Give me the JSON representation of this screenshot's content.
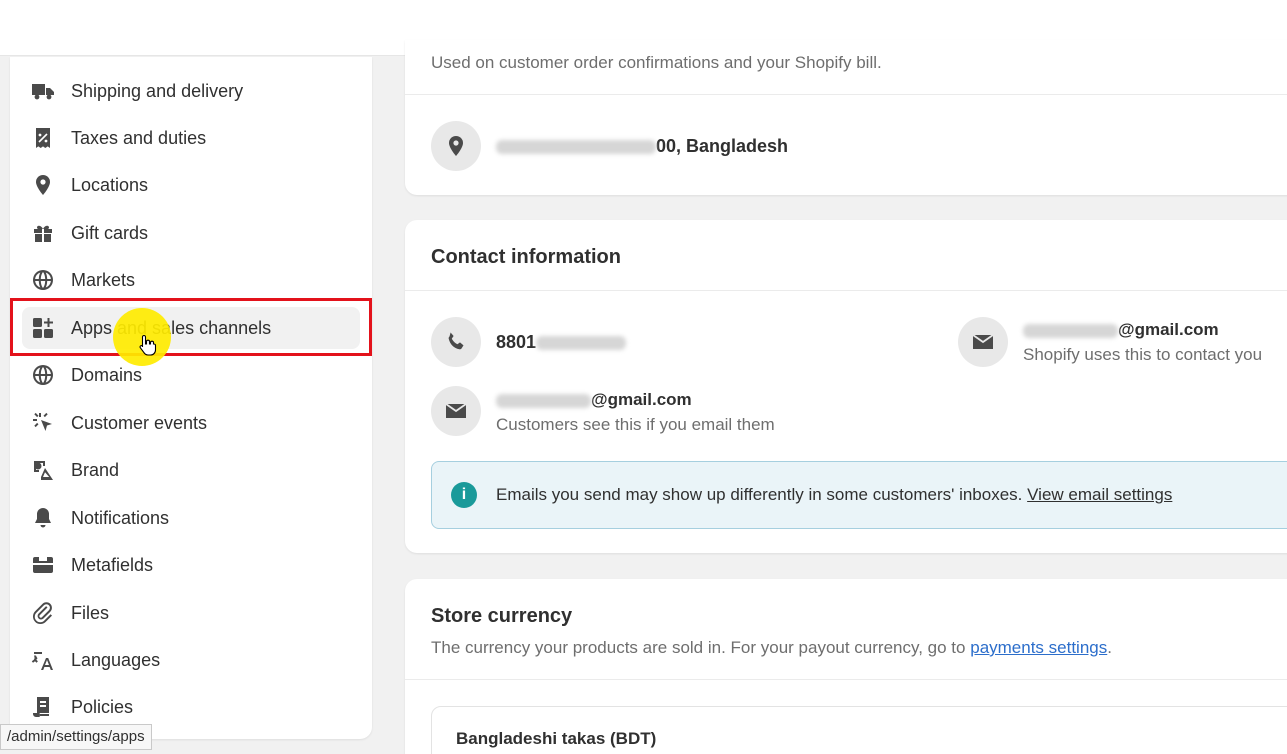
{
  "sidebar": {
    "items": [
      {
        "label": "Shipping and delivery",
        "icon": "truck-icon"
      },
      {
        "label": "Taxes and duties",
        "icon": "receipt-icon"
      },
      {
        "label": "Locations",
        "icon": "location-pin-icon"
      },
      {
        "label": "Gift cards",
        "icon": "gift-icon"
      },
      {
        "label": "Markets",
        "icon": "globe-icon"
      },
      {
        "label": "Apps and sales channels",
        "icon": "apps-add-icon"
      },
      {
        "label": "Domains",
        "icon": "globe-grid-icon"
      },
      {
        "label": "Customer events",
        "icon": "cursor-click-icon"
      },
      {
        "label": "Brand",
        "icon": "brand-shapes-icon"
      },
      {
        "label": "Notifications",
        "icon": "bell-icon"
      },
      {
        "label": "Metafields",
        "icon": "metafields-icon"
      },
      {
        "label": "Files",
        "icon": "paperclip-icon"
      },
      {
        "label": "Languages",
        "icon": "translate-icon"
      },
      {
        "label": "Policies",
        "icon": "policy-document-icon"
      }
    ],
    "active_index": 5
  },
  "status_bar": {
    "url": "/admin/settings/apps"
  },
  "address_card": {
    "caption": "Used on customer order confirmations and your Shopify bill.",
    "address_suffix": "00, Bangladesh"
  },
  "contact_card": {
    "title": "Contact information",
    "phone_prefix": "8801",
    "store_email_suffix": "@gmail.com",
    "store_email_caption": "Shopify uses this to contact you",
    "customer_email_suffix": "@gmail.com",
    "customer_email_caption": "Customers see this if you email them",
    "banner_text": "Emails you send may show up differently in some customers' inboxes.",
    "banner_link": "View email settings"
  },
  "currency_card": {
    "title": "Store currency",
    "description": "The currency your products are sold in. For your payout currency, go to",
    "link": "payments settings",
    "link_suffix": ".",
    "currency_value": "Bangladeshi takas (BDT)"
  },
  "colors": {
    "highlight_border": "#e3121b",
    "cursor_highlight": "#ffeb00",
    "link": "#2c6ecb",
    "info_icon": "#1a9a9a"
  }
}
